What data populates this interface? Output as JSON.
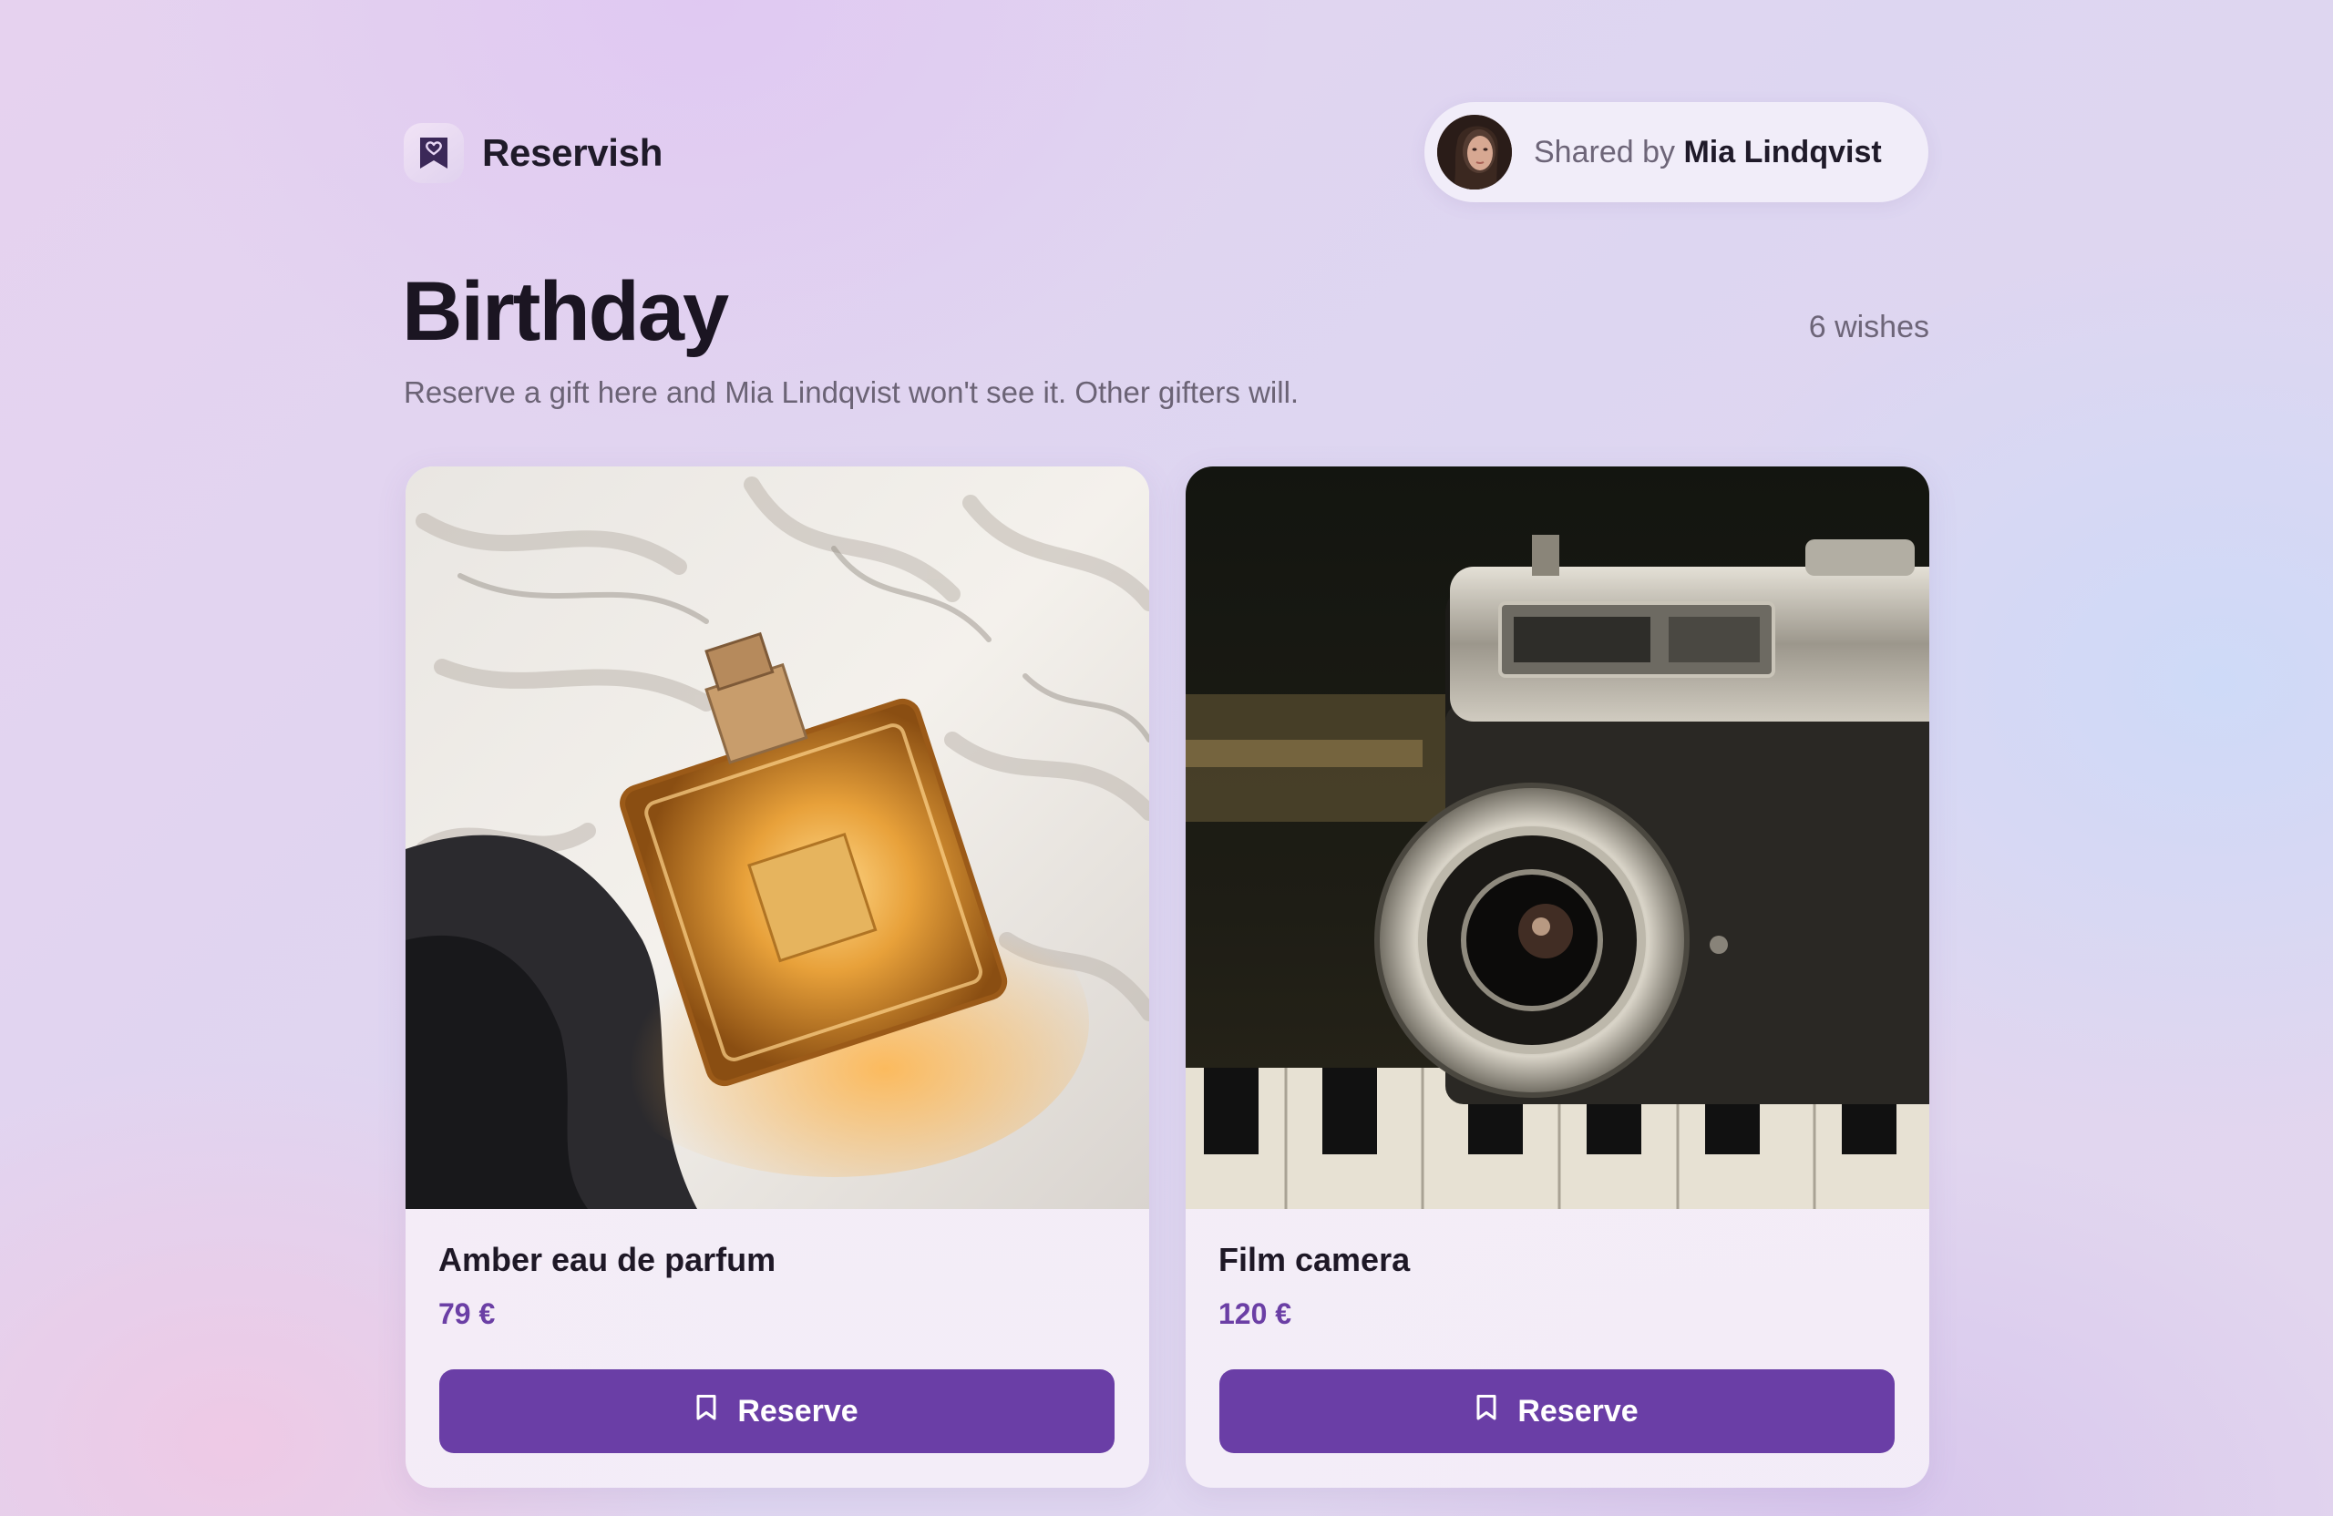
{
  "app": {
    "brand_name": "Reservish",
    "logo_icon": "heart-bookmark-icon",
    "accent_color": "#6a3ea6"
  },
  "share": {
    "prefix": "Shared by",
    "owner_name": "Mia Lindqvist"
  },
  "list": {
    "title": "Birthday",
    "wish_count": "6 wishes",
    "subtitle": "Reserve a gift here and Mia Lindqvist won't see it. Other gifters will."
  },
  "wishes": [
    {
      "name": "Amber eau de parfum",
      "price": "79 €",
      "action_label": "Reserve",
      "action_icon": "bookmark-icon",
      "image": "perfume-bottle-photo"
    },
    {
      "name": "Film camera",
      "price": "120 €",
      "action_label": "Reserve",
      "action_icon": "bookmark-icon",
      "image": "film-camera-photo"
    }
  ]
}
